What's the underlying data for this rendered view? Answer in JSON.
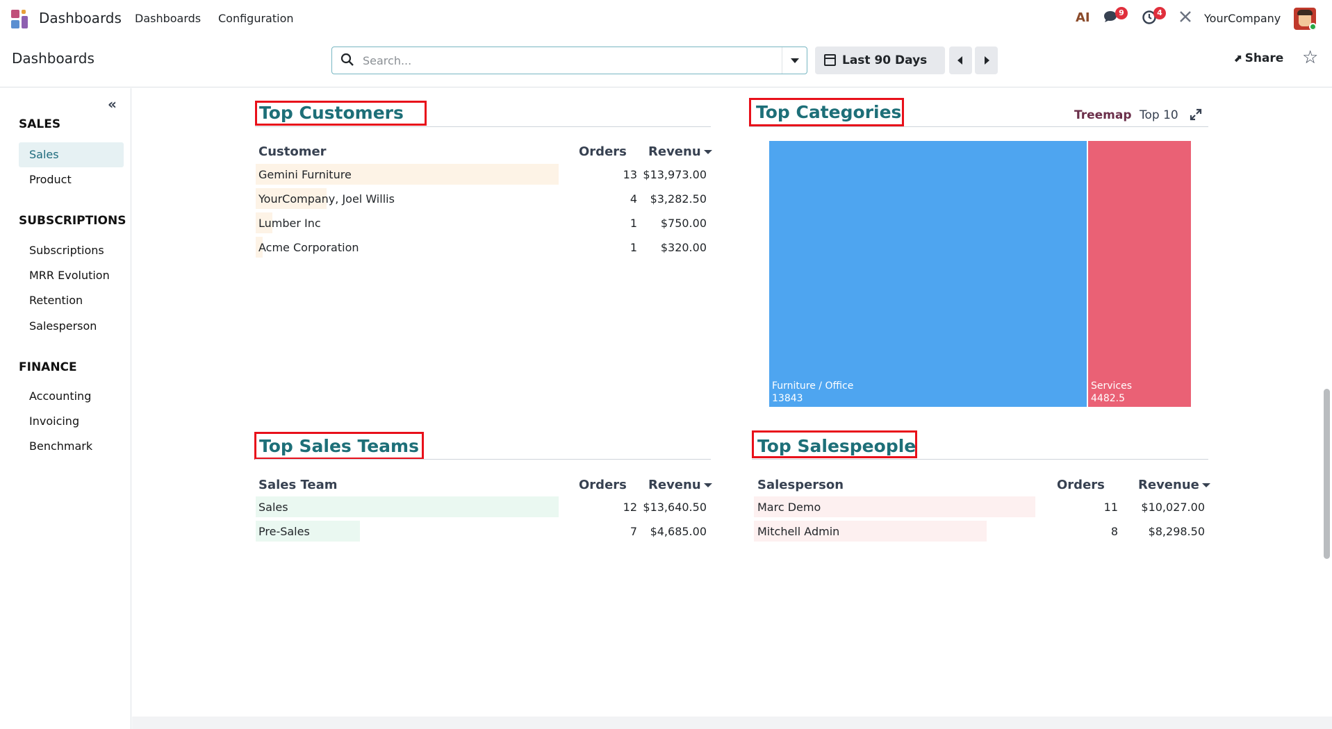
{
  "navbar": {
    "app_name": "Dashboards",
    "menu": [
      "Dashboards",
      "Configuration"
    ],
    "ai_label": "AI",
    "messages_count": "9",
    "activities_count": "4",
    "company": "YourCompany"
  },
  "control_panel": {
    "breadcrumb": "Dashboards",
    "search_placeholder": "Search...",
    "date_filter": "Last 90 Days",
    "share_label": "Share"
  },
  "sidebar": {
    "sections": [
      {
        "title": "SALES",
        "items": [
          "Sales",
          "Product"
        ]
      },
      {
        "title": "SUBSCRIPTIONS",
        "items": [
          "Subscriptions",
          "MRR Evolution",
          "Retention",
          "Salesperson"
        ]
      },
      {
        "title": "FINANCE",
        "items": [
          "Accounting",
          "Invoicing",
          "Benchmark"
        ]
      }
    ],
    "active_item": "Sales"
  },
  "top_customers": {
    "title": "Top Customers",
    "headers": [
      "Customer",
      "Orders",
      "Revenu"
    ],
    "rows": [
      {
        "name": "Gemini Furniture",
        "orders": "13",
        "revenue": "$13,973.00",
        "share": 1.0
      },
      {
        "name": "YourCompany, Joel Willis",
        "orders": "4",
        "revenue": "$3,282.50",
        "share": 0.235
      },
      {
        "name": "Lumber Inc",
        "orders": "1",
        "revenue": "$750.00",
        "share": 0.054
      },
      {
        "name": "Acme Corporation",
        "orders": "1",
        "revenue": "$320.00",
        "share": 0.023
      }
    ]
  },
  "top_categories": {
    "title": "Top Categories",
    "mode_label": "Treemap",
    "limit_label": "Top 10",
    "items": [
      {
        "label": "Furniture / Office",
        "value": "13843",
        "color": "#4ea5f0"
      },
      {
        "label": "Services",
        "value": "4482.5",
        "color": "#ea6175"
      }
    ]
  },
  "top_sales_teams": {
    "title": "Top Sales Teams",
    "headers": [
      "Sales Team",
      "Orders",
      "Revenu"
    ],
    "rows": [
      {
        "name": "Sales",
        "orders": "12",
        "revenue": "$13,640.50",
        "share": 1.0
      },
      {
        "name": "Pre-Sales",
        "orders": "7",
        "revenue": "$4,685.00",
        "share": 0.343
      }
    ]
  },
  "top_salespeople": {
    "title": "Top Salespeople",
    "headers": [
      "Salesperson",
      "Orders",
      "Revenue"
    ],
    "rows": [
      {
        "name": "Marc Demo",
        "orders": "11",
        "revenue": "$10,027.00",
        "share": 1.0
      },
      {
        "name": "Mitchell Admin",
        "orders": "8",
        "revenue": "$8,298.50",
        "share": 0.828
      }
    ]
  },
  "colors": {
    "accent": "#1d6f78",
    "customers_bar": "#fdf3e6",
    "teams_bar": "#eaf8f1",
    "salespeople_bar": "#fdf0f0",
    "annotation_red": "#e8101a"
  }
}
